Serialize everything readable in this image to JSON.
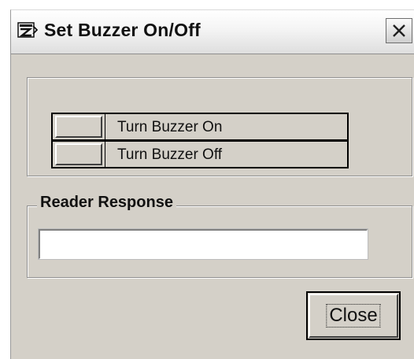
{
  "window": {
    "title": "Set Buzzer On/Off",
    "icon": "app-icon"
  },
  "titlebar": {
    "close_icon": "close-x-icon"
  },
  "commands": [
    {
      "label": "Turn Buzzer On"
    },
    {
      "label": "Turn Buzzer Off"
    }
  ],
  "response": {
    "group_label": "Reader Response",
    "value": ""
  },
  "footer": {
    "close_label": "Close"
  }
}
